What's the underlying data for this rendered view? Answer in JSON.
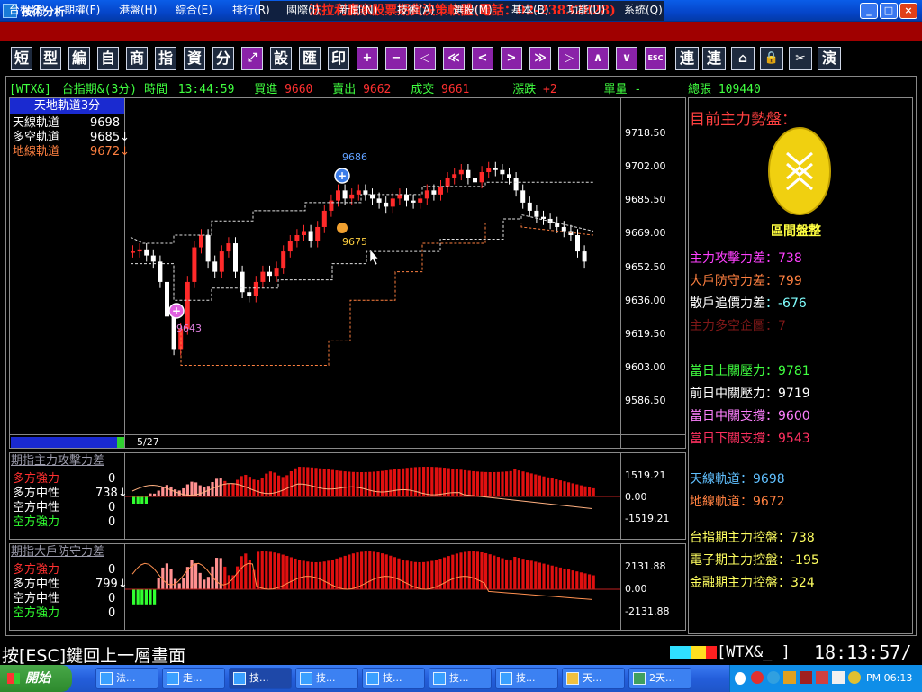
{
  "window": {
    "title": "技術分析",
    "banner": "法拉利贏家股票期貨決策軟體(電話：02-23832828)",
    "min": "_",
    "max": "□",
    "close": "×"
  },
  "menu": [
    "台盤(T)",
    "期權(F)",
    "港盤(H)",
    "綜合(E)",
    "排行(R)",
    "國際(I)",
    "新聞(N)",
    "技術(A)",
    "選股(M)",
    "基本(B)",
    "功能(U)",
    "系統(Q)"
  ],
  "toolbar": [
    "短",
    "型",
    "編",
    "自",
    "商",
    "指",
    "資",
    "分",
    "⤢",
    "設",
    "匯",
    "印",
    "+",
    "−",
    "◁",
    "≪",
    "<",
    ">",
    "≫",
    "▷",
    "∧",
    "∨",
    "ESC",
    "連",
    "連",
    "⌂",
    "🔒",
    "✂",
    "演"
  ],
  "status": {
    "code": "[WTX&]",
    "name": "台指期&(3分)",
    "time_label": "時間",
    "time": "13:44:59",
    "buy_label": "買進",
    "buy": "9660",
    "sell_label": "賣出",
    "sell": "9662",
    "trade_label": "成交",
    "trade": "9661",
    "change_label": "漲跌",
    "change": "+2",
    "volume_label": "單量",
    "volume": "-",
    "total_label": "總張",
    "total": "109440"
  },
  "main_chart": {
    "title": "天地軌道3分",
    "legend": [
      {
        "name": "天線軌道",
        "value": "9698",
        "color": "#ffffff"
      },
      {
        "name": "多空軌道",
        "value": "9685↓",
        "color": "#ffffff"
      },
      {
        "name": "地線軌道",
        "value": "9672↓",
        "color": "#ff8040"
      }
    ],
    "y_ticks": [
      "9718.50",
      "9702.00",
      "9685.50",
      "9669.00",
      "9652.50",
      "9636.00",
      "9619.50",
      "9603.00",
      "9586.50"
    ],
    "date": "5/27",
    "marker_high": "9686",
    "marker_mid": "9675",
    "marker_low": "9643"
  },
  "sub1": {
    "title": "期指主力攻擊力差",
    "legend": [
      {
        "name": "多方強力",
        "value": "0",
        "color": "#ff3030"
      },
      {
        "name": "多方中性",
        "value": "738↓",
        "color": "#ffffff"
      },
      {
        "name": "空方中性",
        "value": "0",
        "color": "#ffffff"
      },
      {
        "name": "空方強力",
        "value": "0",
        "color": "#30ff30"
      }
    ],
    "y_ticks": [
      "1519.21",
      "0.00",
      "-1519.21"
    ]
  },
  "sub2": {
    "title": "期指大戶防守力差",
    "legend": [
      {
        "name": "多方強力",
        "value": "0",
        "color": "#ff3030"
      },
      {
        "name": "多方中性",
        "value": "799↓",
        "color": "#ffffff"
      },
      {
        "name": "空方中性",
        "value": "0",
        "color": "#ffffff"
      },
      {
        "name": "空方強力",
        "value": "0",
        "color": "#30ff30"
      }
    ],
    "y_ticks": [
      "2131.88",
      "0.00",
      "-2131.88"
    ]
  },
  "right_panel": {
    "title": "目前主力勢盤：",
    "coin_label": "區間盤整",
    "stats": [
      {
        "label": "主力攻擊力差",
        "value": "738",
        "color": "#ff40ff"
      },
      {
        "label": "大戶防守力差",
        "value": "799",
        "color": "#ff8040"
      },
      {
        "label": "散戶追價力差",
        "value": "-676",
        "color": "#80ffff"
      },
      {
        "label": "主力多空企圖",
        "value": "7",
        "color": "#801818"
      }
    ],
    "levels": [
      {
        "label": "當日上關壓力",
        "value": "9781",
        "color": "#40ff40"
      },
      {
        "label": "前日中關壓力",
        "value": "9719",
        "color": "#ffffff"
      },
      {
        "label": "當日中關支撐",
        "value": "9600",
        "color": "#ff80ff"
      },
      {
        "label": "當日下關支撐",
        "value": "9543",
        "color": "#ff3060"
      }
    ],
    "rails": [
      {
        "label": "天線軌道",
        "value": "9698",
        "color": "#60c0ff"
      },
      {
        "label": "地線軌道",
        "value": "9672",
        "color": "#ff8040"
      }
    ],
    "control": [
      {
        "label": "台指期主力控盤",
        "value": "738",
        "color": "#ffff60"
      },
      {
        "label": "電子期主力控盤",
        "value": "-195",
        "color": "#ffff60"
      },
      {
        "label": "金融期主力控盤",
        "value": "324",
        "color": "#ffff60"
      }
    ]
  },
  "bottom": {
    "hint": "按[ESC]鍵回上一層畫面",
    "code": "[WTX&_  ]",
    "clock": "18:13:57/"
  },
  "taskbar": {
    "start": "開始",
    "tasks": [
      "法...",
      "走...",
      "技...",
      "技...",
      "技...",
      "技...",
      "技...",
      "天...",
      "2天..."
    ],
    "time": "PM 06:13"
  }
}
